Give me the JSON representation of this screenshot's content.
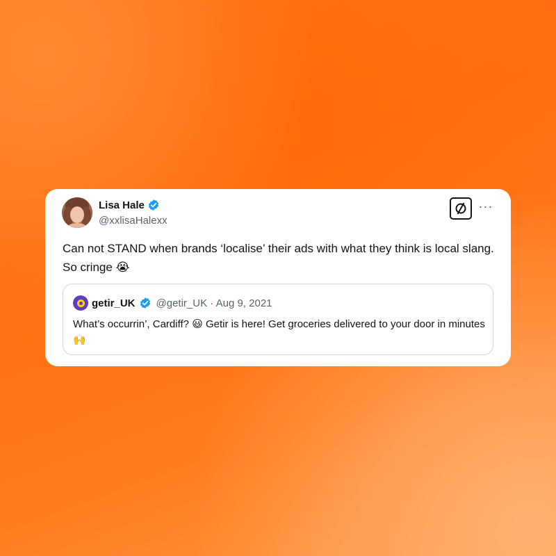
{
  "tweet": {
    "author_name": "Lisa Hale",
    "author_handle": "@xxlisaHalexx",
    "text": "Can not STAND when brands ‘localise’ their ads with what they think is local slang. So cringe",
    "text_emoji": "😭",
    "more_label": "···"
  },
  "quoted_tweet": {
    "author_name": "getir_UK",
    "meta": "@getir_UK · Aug 9, 2021",
    "text_part1": "What’s occurrin’, Cardiff?",
    "emoji1": "😃",
    "text_part2": "Getir is here! Get groceries delivered to your door in minutes",
    "emoji2": "🙌"
  },
  "icons": {
    "verified": "verified-badge-icon",
    "logo": "slashed-circle-logo-icon",
    "more": "more-options-icon"
  },
  "colors": {
    "accent_blue": "#1d9bf0",
    "text_primary": "#0f1419",
    "text_secondary": "#536471",
    "getir_purple": "#5d3ebc",
    "getir_yellow": "#ffd300",
    "background_orange": "#ff7417"
  }
}
